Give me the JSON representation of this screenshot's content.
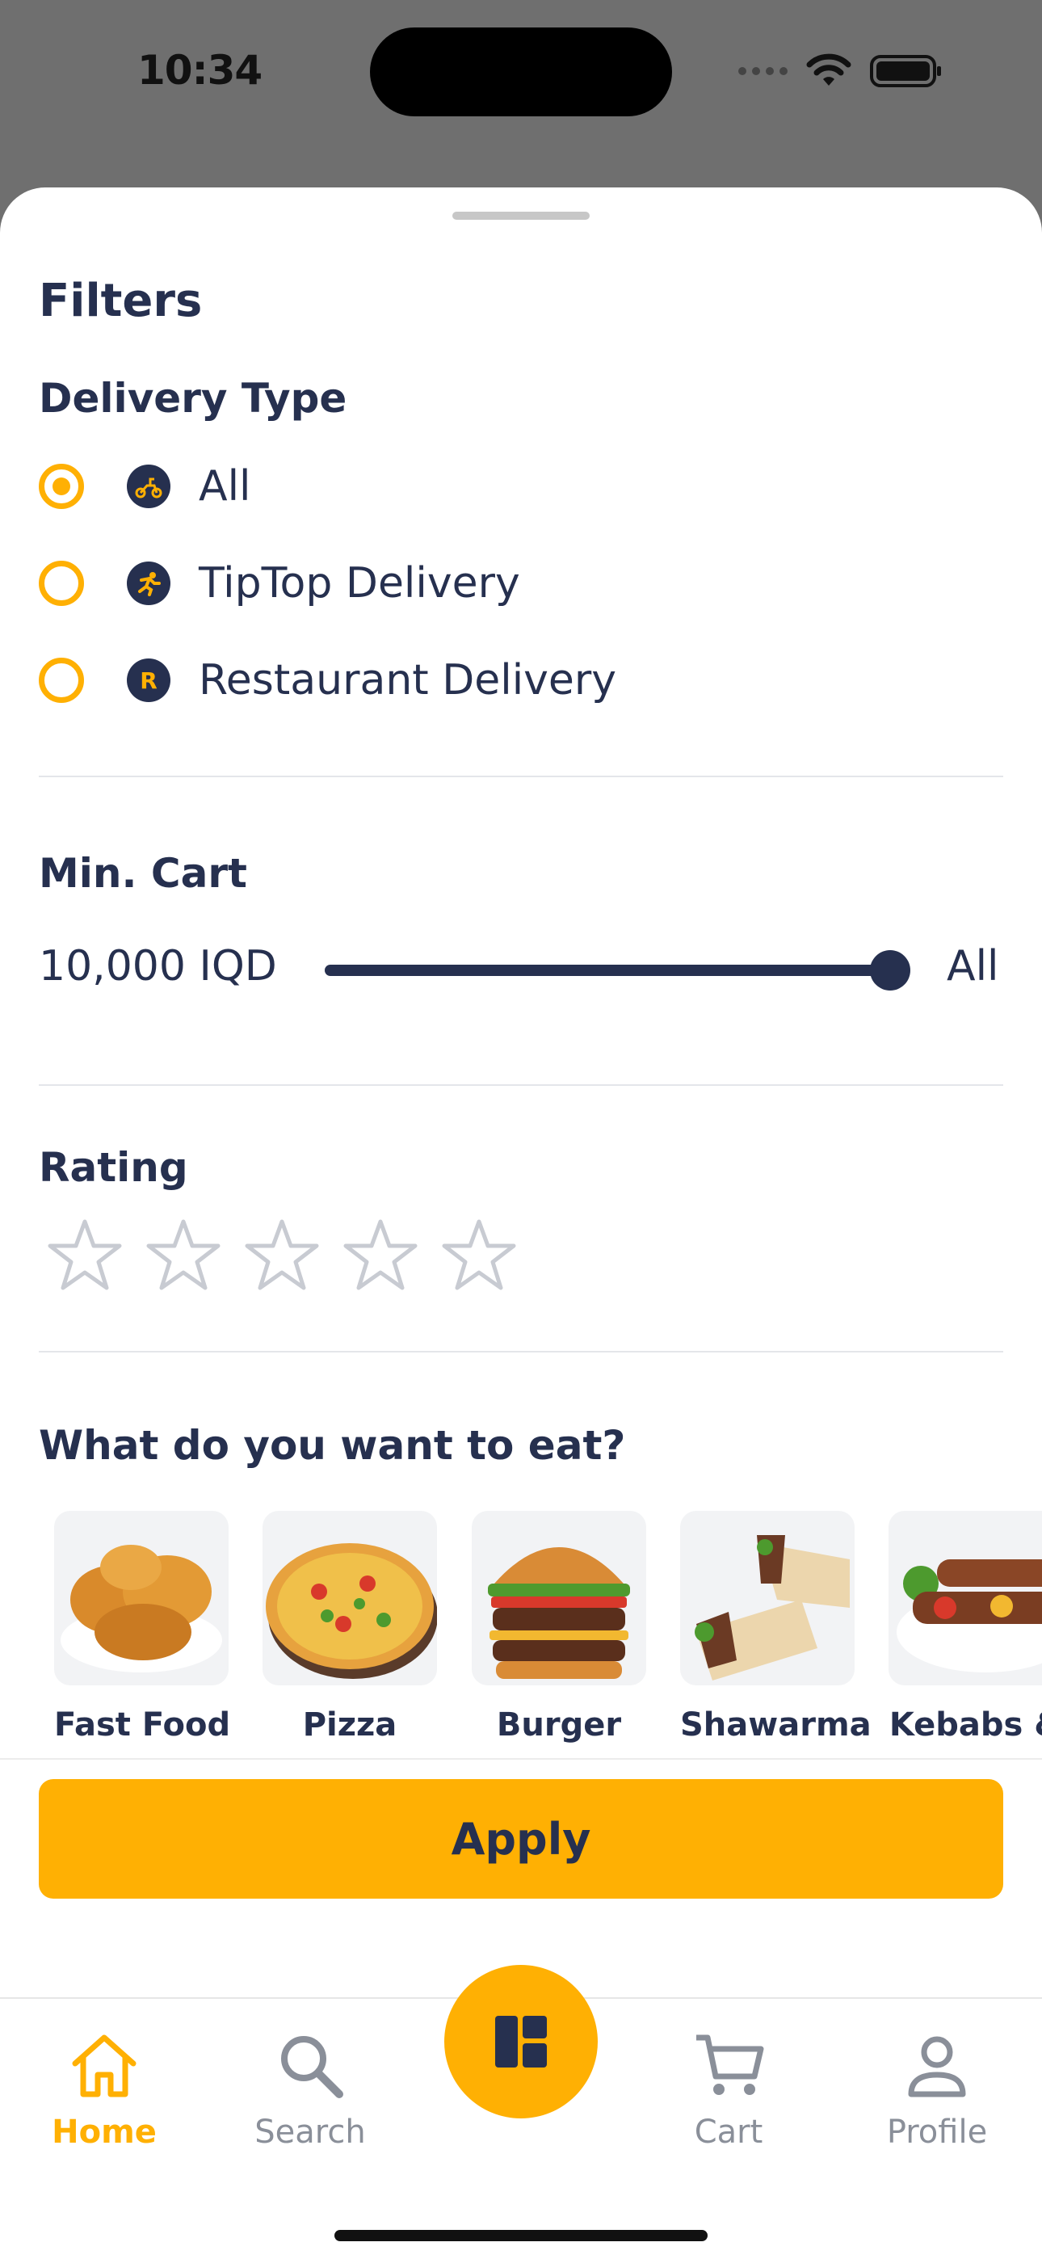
{
  "status_bar": {
    "time": "10:34"
  },
  "filters": {
    "title": "Filters",
    "delivery_type": {
      "title": "Delivery Type",
      "options": [
        {
          "label": "All",
          "selected": true,
          "icon": "scooter-icon"
        },
        {
          "label": "TipTop Delivery",
          "selected": false,
          "icon": "runner-icon"
        },
        {
          "label": "Restaurant Delivery",
          "selected": false,
          "icon": "restaurant-r-icon",
          "badge_text": "R"
        }
      ]
    },
    "min_cart": {
      "title": "Min. Cart",
      "value": "10,000 IQD",
      "end_label": "All",
      "slider_fraction": 1.0
    },
    "rating": {
      "title": "Rating",
      "stars": 5,
      "selected": 0
    },
    "food": {
      "title": "What do you want to eat?",
      "items": [
        {
          "label": "Fast Food",
          "icon": "fried-chicken-image"
        },
        {
          "label": "Pizza",
          "icon": "pizza-image"
        },
        {
          "label": "Burger",
          "icon": "burger-image"
        },
        {
          "label": "Shawarma",
          "icon": "shawarma-image"
        },
        {
          "label": "Kebabs &",
          "icon": "kebabs-image"
        }
      ]
    },
    "apply_label": "Apply"
  },
  "tabbar": {
    "items": [
      {
        "label": "Home",
        "active": true,
        "icon": "home-icon"
      },
      {
        "label": "Search",
        "active": false,
        "icon": "search-icon"
      },
      {
        "label": "Cart",
        "active": false,
        "icon": "cart-icon"
      },
      {
        "label": "Profile",
        "active": false,
        "icon": "profile-icon"
      }
    ],
    "center_icon": "dashboard-icon"
  },
  "colors": {
    "accent": "#ffb003",
    "navy": "#26304f",
    "inactive": "#8a8f99"
  }
}
